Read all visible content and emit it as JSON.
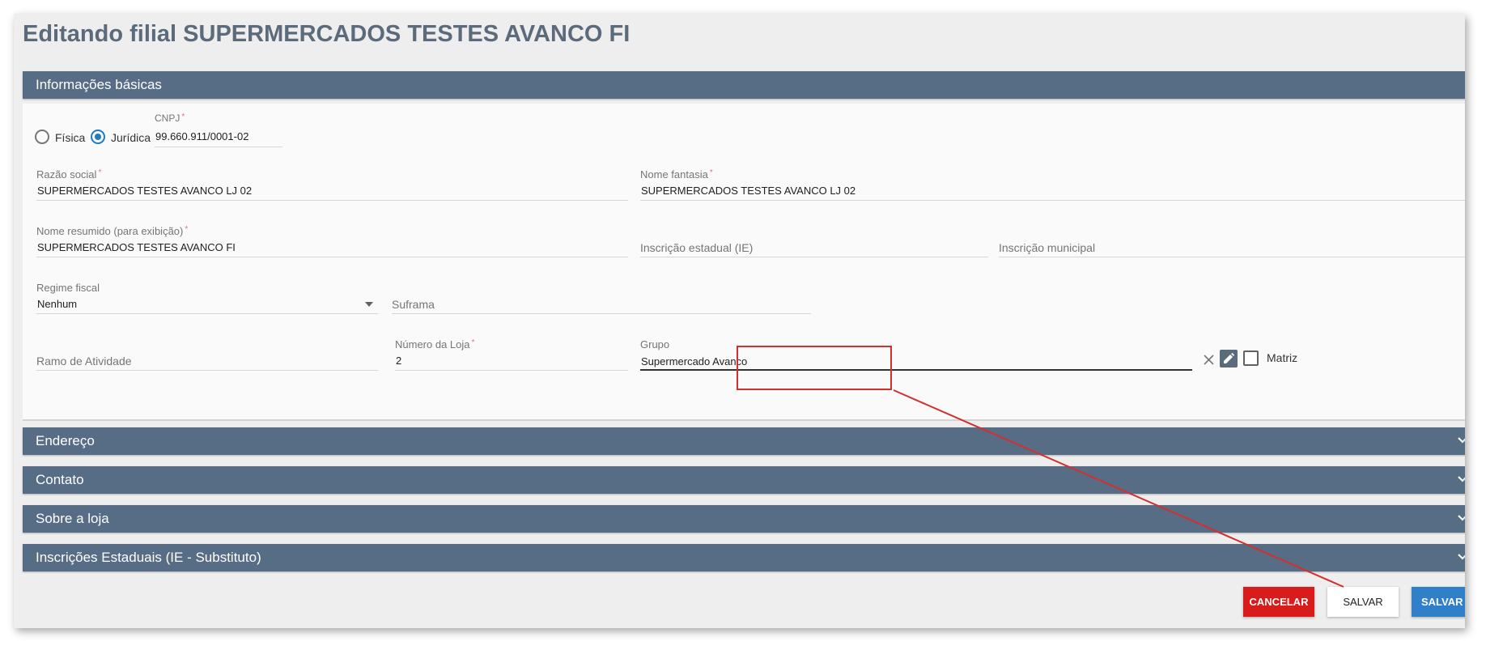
{
  "title": "Editando filial SUPERMERCADOS TESTES AVANCO FI",
  "sections": {
    "basic": "Informações básicas",
    "address": "Endereço",
    "contact": "Contato",
    "about": "Sobre a loja",
    "state_reg": "Inscrições Estaduais (IE - Substituto)"
  },
  "person_type": {
    "fisica": "Física",
    "juridica": "Jurídica",
    "selected": "Jurídica"
  },
  "form": {
    "cnpj": {
      "label": "CNPJ",
      "value": "99.660.911/0001-02"
    },
    "razao_social": {
      "label": "Razão social",
      "value": "SUPERMERCADOS TESTES AVANCO  LJ  02"
    },
    "nome_fantasia": {
      "label": "Nome fantasia",
      "value": "SUPERMERCADOS TESTES AVANCO LJ 02"
    },
    "nome_resumido": {
      "label": "Nome resumido (para exibição)",
      "value": "SUPERMERCADOS TESTES AVANCO FI"
    },
    "inscricao_estadual": {
      "placeholder": "Inscrição estadual (IE)"
    },
    "inscricao_municipal": {
      "placeholder": "Inscrição municipal"
    },
    "regime_fiscal": {
      "label": "Regime fiscal",
      "value": "Nenhum"
    },
    "suframa": {
      "placeholder": "Suframa"
    },
    "ramo_atividade": {
      "placeholder": "Ramo de Atividade"
    },
    "numero_loja": {
      "label": "Número da Loja",
      "value": "2"
    },
    "grupo": {
      "label": "Grupo",
      "value": "Supermercado Avanco"
    },
    "matriz": {
      "label": "Matriz",
      "checked": false
    },
    "required_mark": "*"
  },
  "buttons": {
    "cancel": "CANCELAR",
    "save": "SALVAR",
    "save_primary": "SALVAR"
  },
  "colors": {
    "header_bg": "#576d85",
    "cancel_bg": "#d81b1b",
    "primary_bg": "#2f7fc9",
    "radio_accent": "#1e7bc4",
    "annotation": "#d32f2f"
  }
}
